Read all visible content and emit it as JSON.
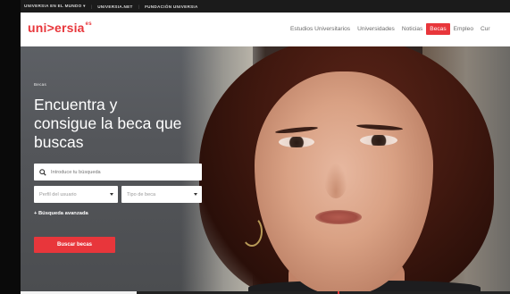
{
  "topbar": {
    "link1": "UNIVERSIA EN EL MUNDO ▾",
    "link2": "UNIVERSIA.NET",
    "link3": "FUNDACIÓN UNIVERSIA"
  },
  "header": {
    "logo_text": "uni>ersia",
    "logo_sup": "es",
    "nav": [
      "Estudios Universitarios",
      "Universidades",
      "Noticias",
      "Becas",
      "Empleo",
      "Cur"
    ]
  },
  "hero": {
    "tag": "Becas",
    "title": "Encuentra y\nconsigue la beca que\nbuscas",
    "search_placeholder": "Introduce tu búsqueda",
    "select_perfil": "Perfil del usuario",
    "select_tipo": "Tipo de beca",
    "advanced_search": "+ Búsqueda avanzada",
    "search_button": "Buscar becas"
  },
  "colors": {
    "accent": "#e8363b",
    "topbar_bg": "#1b1b1b"
  },
  "icons": [
    "search-icon",
    "chevron-down-icon"
  ]
}
